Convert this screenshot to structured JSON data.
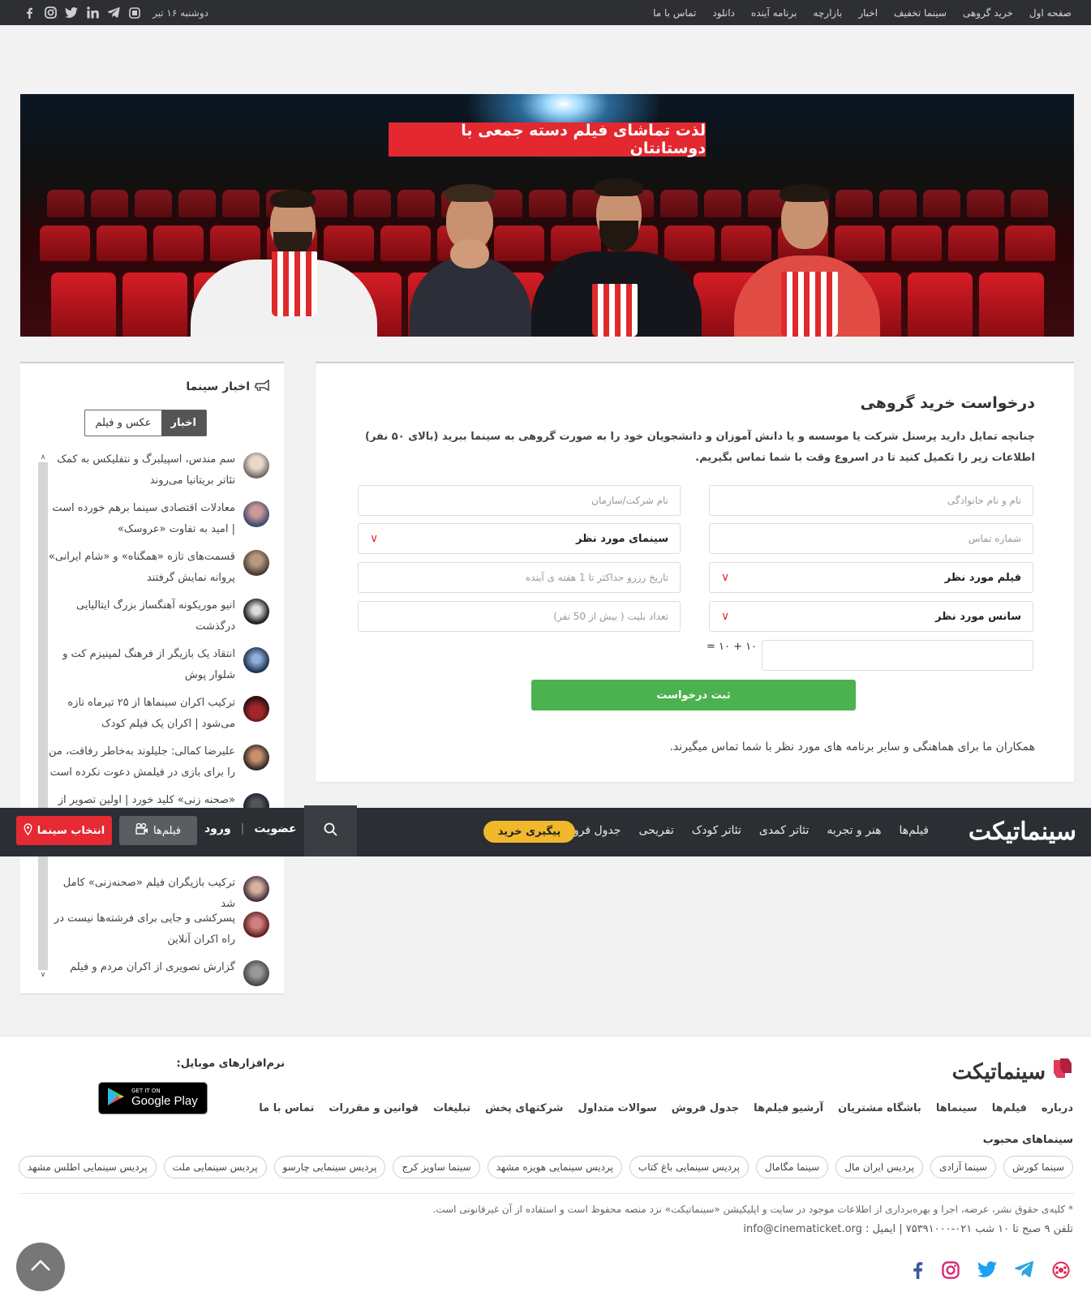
{
  "topbar": {
    "nav": [
      "صفحه اول",
      "خرید گروهی",
      "سینما تخفیف",
      "اخبار",
      "بازارچه",
      "برنامه آینده",
      "دانلود",
      "تماس با ما"
    ],
    "date": "دوشنبه ۱۶ تیر",
    "social_icons": [
      "cinematicket-icon",
      "telegram-icon",
      "linkedin-icon",
      "twitter-icon",
      "instagram-icon",
      "facebook-icon"
    ]
  },
  "banner": {
    "title": "لذت تماشای فیلم دسته جمعی با دوستانتان"
  },
  "form": {
    "title": "درخواست خرید گروهی",
    "description": "چنانچه تمایل دارید پرسنل شرکت یا موسسه و یا دانش آموزان و دانشجویان خود را به صورت گروهی به سینما ببرید (بالای ۵۰ نفر) اطلاعات زیر را تکمیل کنید تا در اسروع وقت با شما تماس بگیریم.",
    "name_placeholder": "نام و نام خانوادگی",
    "company_placeholder": "نام شرکت/سازمان",
    "phone_placeholder": "شماره تماس",
    "cinema_select": "سینمای مورد نظر",
    "film_select": "فیلم مورد نظر",
    "date_placeholder": "تاریخ رزرو حداکثر تا 1 هفته ی آینده",
    "session_select": "سانس مورد نظر",
    "tickets_placeholder": "تعداد بلیت ( بیش از 50 نفر)",
    "captcha": "۱۰ + ۱۰ =",
    "submit_label": "ثبت درخواست",
    "note": "همکاران ما برای هماهنگی و سایر برنامه های مورد نظر با شما تماس میگیرند."
  },
  "news": {
    "title": "اخبار سینما",
    "tab_active": "اخبار",
    "tab_other": "عکس و فیلم",
    "items": [
      "سم مندس، اسپیلبرگ و نتفلیکس به کمک تئاتر بریتانیا می‌روند",
      "معادلات اقتصادی سینما برهم خورده است | امید به تفاوت «عروسک»",
      "قسمت‌های تازه «همگناه» و «شام ایرانی» پروانه نمایش گرفتند",
      "انیو موریکونه آهنگساز بزرگ ایتالیایی درگذشت",
      "انتقاد یک بازیگر از فرهنگ لمپنیزم کت و شلوار پوش",
      "ترکیب اکران سینماها از ۲۵ تیرماه تازه می‌شود | اکران یک فیلم کودک",
      "علیرضا کمالی: جلیلوند به‌خاطر رفاقت، من را برای بازی در فیلمش دعوت نکرده است",
      "«صحنه زنی» کلید خورد | اولین تصویر از",
      "ترکیب بازیگران فیلم «صحنه‌زنی» کامل شد",
      "پسرکشی و جایی برای فرشته‌ها نیست در راه اکران آنلاین",
      "گزارش تصویری از اکران مردم و فیلم"
    ]
  },
  "sticky": {
    "logo": "سینماتیکت",
    "nav": [
      "فیلم‌ها",
      "هنر و تجربه",
      "تئاتر کمدی",
      "تئاتر کودک",
      "تفریحی",
      "جدول فروش"
    ],
    "track": "پیگیری خرید",
    "register": "عضویت",
    "login": "ورود",
    "films": "فیلم‌ها",
    "choose_cinema": "انتخاب سینما"
  },
  "footer": {
    "logo": "سینماتیکت",
    "links": [
      "درباره",
      "فیلم‌ها",
      "سینماها",
      "باشگاه مشتریان",
      "آرشیو فیلم‌ها",
      "جدول فروش",
      "سوالات متداول",
      "شرکتهای پخش",
      "تبلیغات",
      "قوانین و مقررات",
      "تماس با ما"
    ],
    "fav_title": "سینماهای محبوب",
    "favorites": [
      "سینما کورش",
      "سینما آزادی",
      "پردیس ایران مال",
      "سینما مگامال",
      "پردیس سینمایی باغ کتاب",
      "پردیس سینمایی هویزه مشهد",
      "سینما ساویز کرج",
      "پردیس سینمایی چارسو",
      "پردیس سینمایی ملت",
      "پردیس سینمایی اطلس مشهد"
    ],
    "mobile_title": "نرم‌افزارهای موبایل:",
    "gplay_small": "GET IT ON",
    "gplay_big": "Google Play",
    "copyright": "* کلیه‌ی حقوق نشر، عرضه، اجرا و بهره‌برداری از اطلاعات موجود در سایت و اپلیکیشن «سینماتیکت» نزد منصه محفوظ است و استفاده از آن غیرقانونی است.",
    "contact": "تلفن ۹ صبح تا ۱۰ شب ۰۲۱-۷۵۳۹۱۰۰۰ | ایمیل : info@cinematicket.org"
  }
}
